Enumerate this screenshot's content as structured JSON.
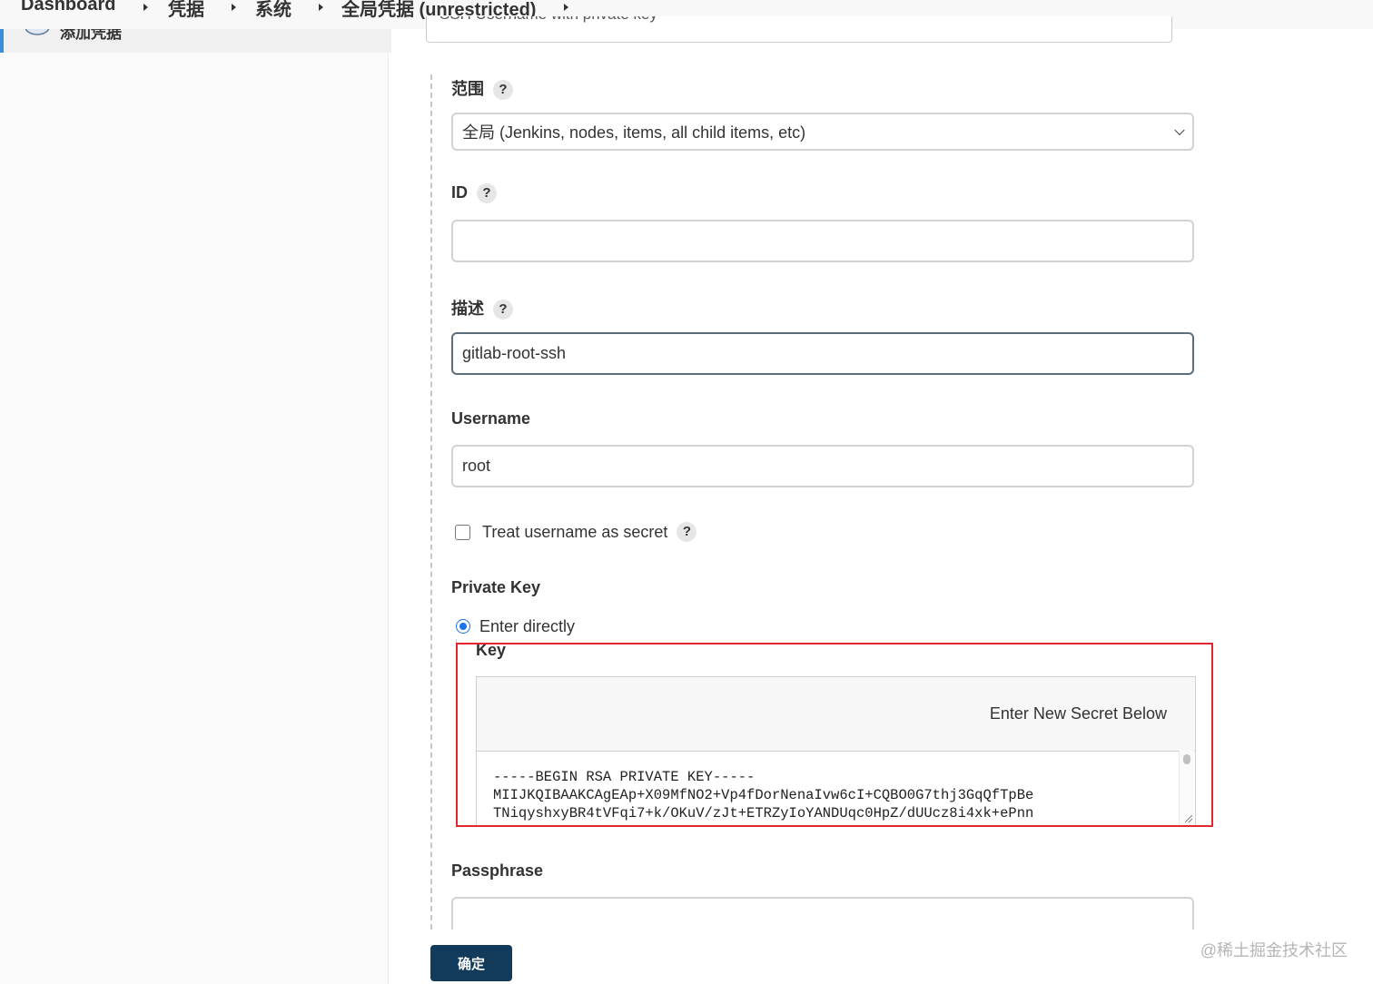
{
  "breadcrumb": {
    "items": [
      "Dashboard",
      "凭据",
      "系统",
      "全局凭据 (unrestricted)"
    ]
  },
  "sidebar": {
    "item_label": "添加凭据"
  },
  "form": {
    "kind_value": "SSH Username with private key",
    "scope": {
      "label": "范围",
      "help": "?",
      "value": "全局 (Jenkins, nodes, items, all child items, etc)"
    },
    "id": {
      "label": "ID",
      "help": "?",
      "value": ""
    },
    "description": {
      "label": "描述",
      "help": "?",
      "value": "gitlab-root-ssh"
    },
    "username": {
      "label": "Username",
      "value": "root"
    },
    "treat_secret": {
      "label": "Treat username as secret",
      "help": "?",
      "checked": false
    },
    "private_key": {
      "label": "Private Key",
      "option_label": "Enter directly",
      "selected": true,
      "key_label": "Key",
      "key_header": "Enter New Secret Below",
      "key_lines": [
        "-----BEGIN RSA PRIVATE KEY-----",
        "MIIJKQIBAAKCAgEAp+X09MfNO2+Vp4fDorNenaIvw6cI+CQBO0G7thj3GqQfTpBe",
        "TNiqyshxyBR4tVFqi7+k/OKuV/zJt+ETRZyIoYANDUqc0HpZ/dUUcz8i4xk+ePnn"
      ]
    },
    "passphrase": {
      "label": "Passphrase",
      "value": ""
    },
    "submit_label": "确定"
  },
  "watermark": "@稀土掘金技术社区",
  "colors": {
    "submit_bg": "#123a5a",
    "highlight_border": "#e3262d",
    "radio_accent": "#1a73e8",
    "sidebar_accent": "#3a8fd6"
  },
  "icons": {
    "separator": "caret-right-icon",
    "select": "chevron-down-icon",
    "sidebar": "credentials-key-icon",
    "help": "help-question-icon"
  }
}
